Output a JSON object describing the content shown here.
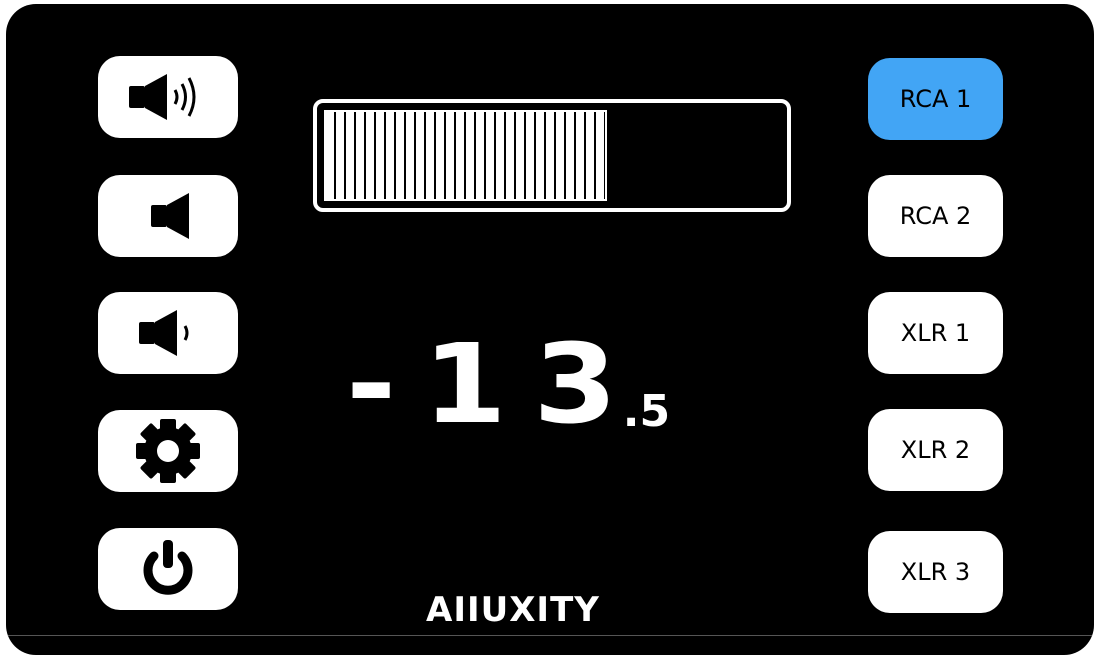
{
  "left_controls": [
    {
      "name": "volume-up-icon"
    },
    {
      "name": "mute-icon"
    },
    {
      "name": "volume-down-icon"
    },
    {
      "name": "settings-icon"
    },
    {
      "name": "power-icon"
    }
  ],
  "meter": {
    "level_fraction": 0.62
  },
  "readout": {
    "main": "-13",
    "decimal": ".5"
  },
  "inputs": [
    {
      "label": "RCA 1",
      "active": true
    },
    {
      "label": "RCA 2",
      "active": false
    },
    {
      "label": "XLR 1",
      "active": false
    },
    {
      "label": "XLR 2",
      "active": false
    },
    {
      "label": "XLR 3",
      "active": false
    }
  ],
  "brand": "AIIUXITY",
  "colors": {
    "active": "#42a5f5",
    "background": "#000000",
    "button": "#ffffff"
  }
}
